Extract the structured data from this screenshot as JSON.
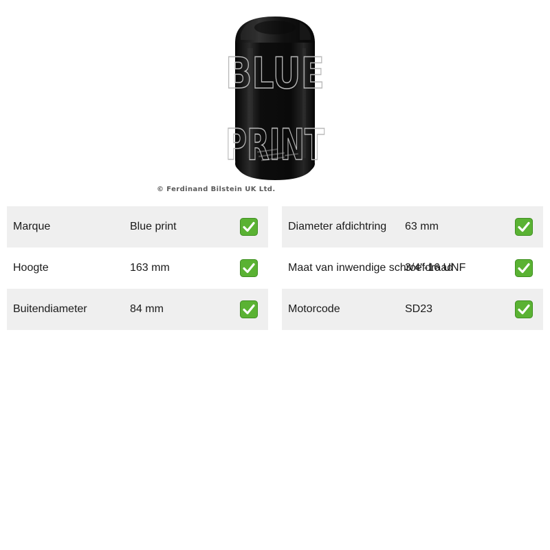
{
  "product": {
    "image_icon": "oil-filter-image",
    "watermark_lines": [
      "BLUE",
      "PRINT"
    ],
    "copyright": "© Ferdinand Bilstein UK Ltd."
  },
  "specs": {
    "left": [
      {
        "label": "Marque",
        "value": "Blue print",
        "icon": "check-icon"
      },
      {
        "label": "Hoogte",
        "value": "163 mm",
        "icon": "check-icon"
      },
      {
        "label": "Buitendiameter",
        "value": "84 mm",
        "icon": "check-icon"
      }
    ],
    "right": [
      {
        "label": "Diameter afdichtring",
        "value": "63 mm",
        "icon": "check-icon"
      },
      {
        "label": "Maat van inwendige schroefdraad",
        "value": "3/4\"-16 UNF",
        "icon": "check-icon"
      },
      {
        "label": "Motorcode",
        "value": "SD23",
        "icon": "check-icon"
      }
    ]
  },
  "colors": {
    "row_shade": "#efefef",
    "check_green": "#5ab233",
    "filter_body": "#111111"
  }
}
